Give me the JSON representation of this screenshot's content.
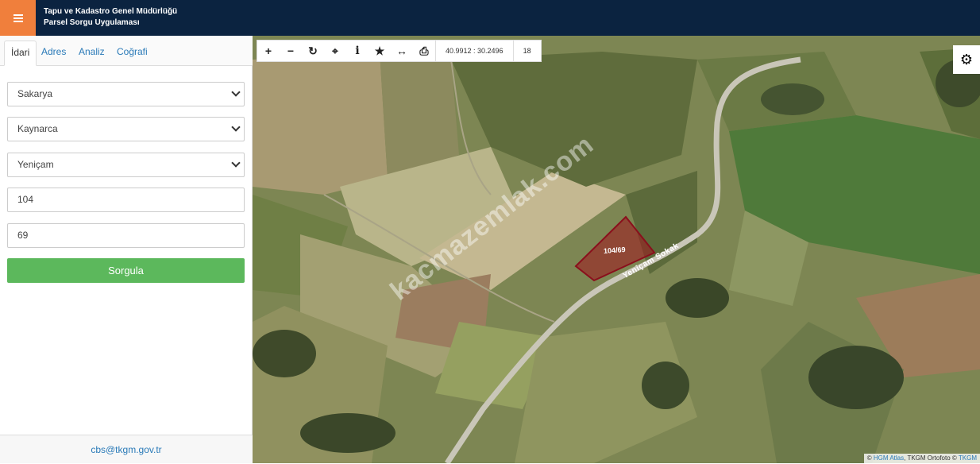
{
  "header": {
    "title_line1": "Tapu ve Kadastro Genel Müdürlüğü",
    "title_line2": "Parsel Sorgu Uygulaması",
    "menu_icon": "hamburger-icon",
    "brand_color": "#0b2340",
    "accent_color": "#f07f3c"
  },
  "sidebar": {
    "tabs": [
      {
        "label": "İdari",
        "active": true
      },
      {
        "label": "Adres",
        "active": false
      },
      {
        "label": "Analiz",
        "active": false
      },
      {
        "label": "Coğrafi",
        "active": false
      }
    ],
    "fields": {
      "province": "Sakarya",
      "district": "Kaynarca",
      "neighborhood": "Yeniçam",
      "block": "104",
      "parcel": "69"
    },
    "query_button": "Sorgula",
    "query_button_color": "#5cb85c",
    "footer_email": "cbs@tkgm.gov.tr"
  },
  "map": {
    "toolbar": {
      "zoom_in_icon": "plus-icon",
      "zoom_out_icon": "minus-icon",
      "refresh_icon": "refresh-icon",
      "locate_icon": "crosshair-icon",
      "info_icon": "info-icon",
      "favorite_icon": "star-icon",
      "measure_icon": "measure-icon",
      "print_icon": "print-icon",
      "coordinates": "40.9912 : 30.2496",
      "zoom_level": "18"
    },
    "settings_icon": "gear-icon",
    "parcel_label": "104/69",
    "road_label": "Yeniçam Sokak",
    "watermark": "kacmazemlak.com",
    "attribution": {
      "prefix": "©",
      "hgm": "HGM Atlas",
      "tkgm_ortofoto": "TKGM Ortofoto",
      "copyright": "©",
      "tkgm": "TKGM"
    }
  }
}
